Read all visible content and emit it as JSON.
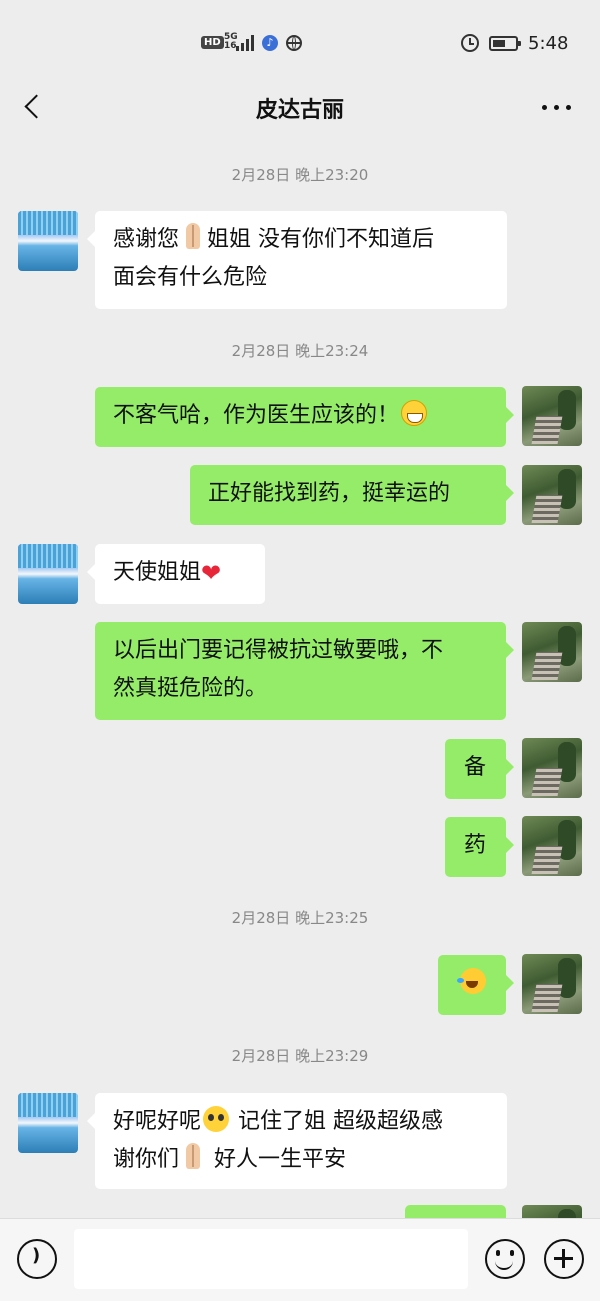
{
  "status_bar": {
    "hd": "HD",
    "network": "5G",
    "network_sub": "16",
    "time": "5:48"
  },
  "header": {
    "title": "皮达古丽"
  },
  "timestamps": [
    "2月28日 晚上23:20",
    "2月28日 晚上23:24",
    "2月28日 晚上23:25",
    "2月28日 晚上23:29"
  ],
  "messages": [
    {
      "from": "other",
      "text_a": "感谢您",
      "text_b": "姐姐 没有你们不知道后",
      "text_c": "面会有什么危险"
    },
    {
      "from": "me",
      "text": "不客气哈，作为医生应该的！"
    },
    {
      "from": "me",
      "text": "正好能找到药，挺幸运的"
    },
    {
      "from": "other",
      "text": "天使姐姐"
    },
    {
      "from": "me",
      "text_a": "以后出门要记得被抗过敏要哦，不",
      "text_b": "然真挺危险的。"
    },
    {
      "from": "me",
      "text": "备"
    },
    {
      "from": "me",
      "text": "药"
    },
    {
      "from": "me",
      "text": ""
    },
    {
      "from": "other",
      "text_a": "好呢好呢",
      "text_b": " 记住了姐 超级超级感",
      "text_c": "谢你们",
      "text_d": " 好人一生平安"
    }
  ],
  "icons": {
    "back": "chevron-left-icon",
    "more": "more-dots-icon",
    "voice": "voice-icon",
    "emoji": "emoji-icon",
    "add": "plus-icon"
  },
  "colors": {
    "background": "#ededed",
    "my_bubble": "#95ec69",
    "other_bubble": "#ffffff"
  }
}
